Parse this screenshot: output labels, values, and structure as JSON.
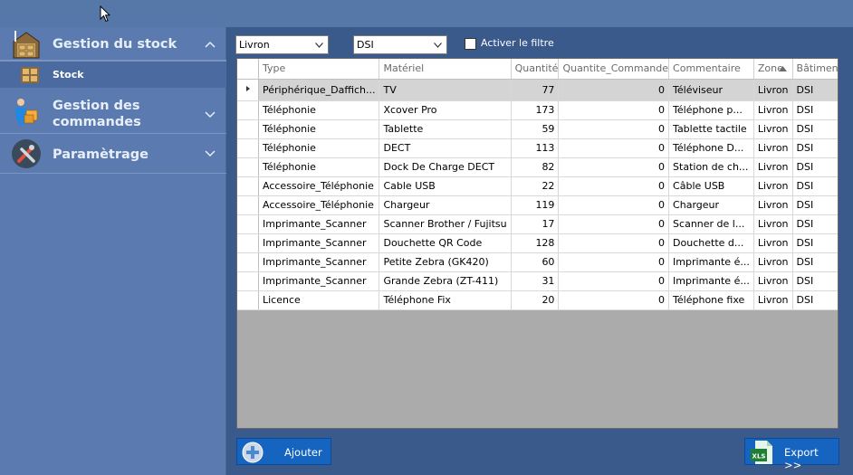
{
  "sidebar": {
    "groups": [
      {
        "label": "Gestion du stock",
        "icon": "warehouse-icon",
        "expanded": true,
        "items": [
          {
            "label": "Stock",
            "icon": "shelves-icon"
          }
        ]
      },
      {
        "label_line1": "Gestion des",
        "label_line2": "commandes",
        "icon": "delivery-icon",
        "expanded": false
      },
      {
        "label": "Paramètrage",
        "icon": "tools-icon",
        "expanded": false
      }
    ]
  },
  "filters": {
    "zone_value": "Livron",
    "batiment_value": "DSI",
    "activate_label": "Activer le filtre",
    "activate_checked": false
  },
  "grid": {
    "columns": [
      "Type",
      "Matériel",
      "Quantité",
      "Quantite_Commande",
      "Commentaire",
      "Zone",
      "Bâtiment"
    ],
    "sorted_column": "Zone",
    "sort_direction": "ascending",
    "selected_row": 0,
    "rows": [
      [
        "Périphérique_Daffich...",
        "TV",
        "77",
        "0",
        "Téléviseur",
        "Livron",
        "DSI"
      ],
      [
        "Téléphonie",
        "Xcover Pro",
        "173",
        "0",
        "Téléphone p...",
        "Livron",
        "DSI"
      ],
      [
        "Téléphonie",
        "Tablette",
        "59",
        "0",
        "Tablette tactile",
        "Livron",
        "DSI"
      ],
      [
        "Téléphonie",
        "DECT",
        "113",
        "0",
        "Téléphone D...",
        "Livron",
        "DSI"
      ],
      [
        "Téléphonie",
        "Dock De Charge DECT",
        "82",
        "0",
        "Station de ch...",
        "Livron",
        "DSI"
      ],
      [
        "Accessoire_Téléphonie",
        "Cable USB",
        "22",
        "0",
        "Câble USB",
        "Livron",
        "DSI"
      ],
      [
        "Accessoire_Téléphonie",
        "Chargeur",
        "119",
        "0",
        "Chargeur",
        "Livron",
        "DSI"
      ],
      [
        "Imprimante_Scanner",
        "Scanner Brother / Fujitsu",
        "17",
        "0",
        "Scanner de l...",
        "Livron",
        "DSI"
      ],
      [
        "Imprimante_Scanner",
        "Douchette QR Code",
        "128",
        "0",
        "Douchette d...",
        "Livron",
        "DSI"
      ],
      [
        "Imprimante_Scanner",
        "Petite Zebra (GK420)",
        "60",
        "0",
        "Imprimante é...",
        "Livron",
        "DSI"
      ],
      [
        "Imprimante_Scanner",
        "Grande Zebra (ZT-411)",
        "31",
        "0",
        "Imprimante é...",
        "Livron",
        "DSI"
      ],
      [
        "Licence",
        "Téléphone Fix",
        "20",
        "0",
        "Téléphone fixe",
        "Livron",
        "DSI"
      ]
    ]
  },
  "buttons": {
    "add_label": "Ajouter",
    "export_label": "Export >>",
    "export_icon_text": "XLS"
  },
  "colors": {
    "sidebar": "#5b7bb0",
    "sidebar_selected": "#4a6aa0",
    "main_background": "#3a5a8c",
    "button": "#1565c0",
    "selected_row": "#d4d4d4"
  }
}
